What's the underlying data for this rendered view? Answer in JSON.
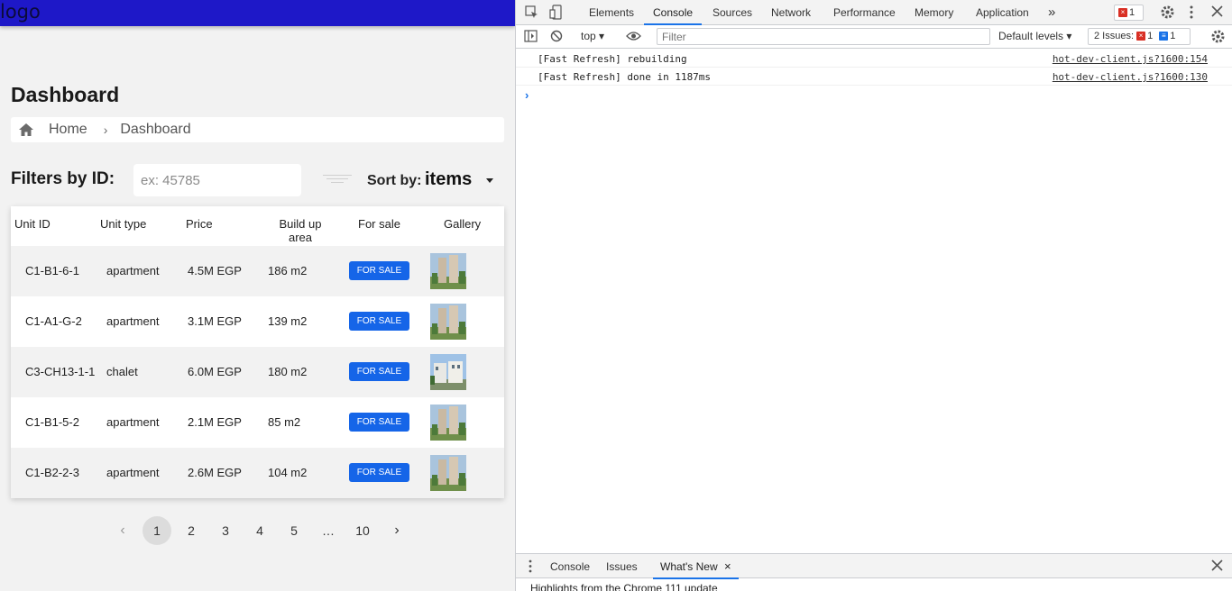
{
  "app": {
    "logo_text": "logo",
    "page_title": "Dashboard",
    "breadcrumb": {
      "home": "Home",
      "separator": "›",
      "current": "Dashboard"
    },
    "filters": {
      "label": "Filters by ID:",
      "placeholder": "ex: 45785",
      "sort_label": "Sort by:",
      "sort_value": "items"
    },
    "table": {
      "columns": [
        "Unit ID",
        "Unit type",
        "Price",
        "Build up area",
        "For sale",
        "Gallery"
      ],
      "rows": [
        {
          "id": "C1-B1-6-1",
          "type": "apartment",
          "price": "4.5M EGP",
          "area": "186 m2",
          "status": "FOR SALE"
        },
        {
          "id": "C1-A1-G-2",
          "type": "apartment",
          "price": "3.1M EGP",
          "area": "139 m2",
          "status": "FOR SALE"
        },
        {
          "id": "C3-CH13-1-1",
          "type": "chalet",
          "price": "6.0M EGP",
          "area": "180 m2",
          "status": "FOR SALE"
        },
        {
          "id": "C1-B1-5-2",
          "type": "apartment",
          "price": "2.1M EGP",
          "area": "85 m2",
          "status": "FOR SALE"
        },
        {
          "id": "C1-B2-2-3",
          "type": "apartment",
          "price": "2.6M EGP",
          "area": "104 m2",
          "status": "FOR SALE"
        }
      ]
    },
    "pagination": {
      "pages": [
        "1",
        "2",
        "3",
        "4",
        "5",
        "…",
        "10"
      ],
      "current": "1"
    },
    "colors": {
      "topbar": "#1e18c8",
      "button": "#1565e8",
      "background": "#f2f2f2"
    }
  },
  "devtools": {
    "tabs": [
      "Elements",
      "Console",
      "Sources",
      "Network",
      "Performance",
      "Memory",
      "Application"
    ],
    "active_tab": "Console",
    "more": "»",
    "error_count": "1",
    "context": "top",
    "filter_placeholder": "Filter",
    "levels": "Default levels",
    "issues_label": "2 Issues:",
    "issues_errors": "1",
    "issues_info": "1",
    "logs": [
      {
        "message": "[Fast Refresh] rebuilding",
        "source": "hot-dev-client.js?1600:154"
      },
      {
        "message": "[Fast Refresh] done in 1187ms",
        "source": "hot-dev-client.js?1600:130"
      }
    ],
    "prompt": "›",
    "drawer_tabs": [
      "Console",
      "Issues",
      "What's New"
    ],
    "drawer_active": "What's New",
    "drawer_text": "Highlights from the Chrome 111 update"
  }
}
